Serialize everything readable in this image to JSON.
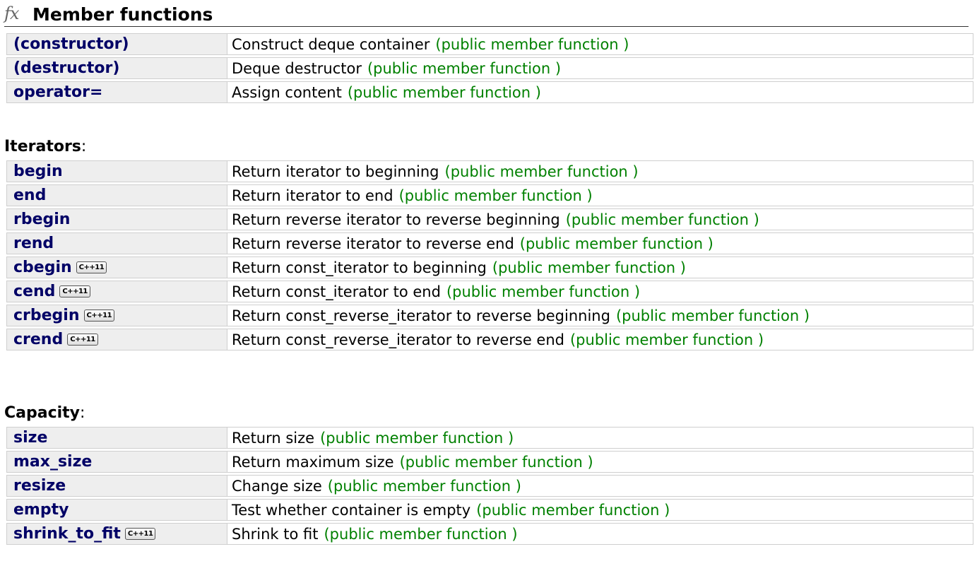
{
  "header": {
    "icon": "fx-icon",
    "title": "Member functions"
  },
  "colors": {
    "member_link": "#000066",
    "kind_text": "#008000",
    "name_cell_bg": "#eeeeee",
    "border": "#cfcfcf"
  },
  "groups": [
    {
      "title": "",
      "rows": [
        {
          "name": "(constructor)",
          "cpp11": false,
          "desc": "Construct deque container",
          "kind": "(public member function )"
        },
        {
          "name": "(destructor)",
          "cpp11": false,
          "desc": "Deque destructor",
          "kind": "(public member function )"
        },
        {
          "name": "operator=",
          "cpp11": false,
          "desc": "Assign content",
          "kind": "(public member function )"
        }
      ]
    },
    {
      "title": "Iterators",
      "rows": [
        {
          "name": "begin",
          "cpp11": false,
          "desc": "Return iterator to beginning",
          "kind": "(public member function )"
        },
        {
          "name": "end",
          "cpp11": false,
          "desc": "Return iterator to end",
          "kind": "(public member function )"
        },
        {
          "name": "rbegin",
          "cpp11": false,
          "desc": "Return reverse iterator to reverse beginning",
          "kind": "(public member function )"
        },
        {
          "name": "rend",
          "cpp11": false,
          "desc": "Return reverse iterator to reverse end",
          "kind": "(public member function )"
        },
        {
          "name": "cbegin",
          "cpp11": true,
          "desc": "Return const_iterator to beginning",
          "kind": "(public member function )"
        },
        {
          "name": "cend",
          "cpp11": true,
          "desc": "Return const_iterator to end",
          "kind": "(public member function )"
        },
        {
          "name": "crbegin",
          "cpp11": true,
          "desc": "Return const_reverse_iterator to reverse beginning",
          "kind": "(public member function )"
        },
        {
          "name": "crend",
          "cpp11": true,
          "desc": "Return const_reverse_iterator to reverse end",
          "kind": "(public member function )"
        }
      ]
    },
    {
      "title": "Capacity",
      "rows": [
        {
          "name": "size",
          "cpp11": false,
          "desc": "Return size",
          "kind": "(public member function )"
        },
        {
          "name": "max_size",
          "cpp11": false,
          "desc": "Return maximum size",
          "kind": "(public member function )"
        },
        {
          "name": "resize",
          "cpp11": false,
          "desc": "Change size",
          "kind": "(public member function )"
        },
        {
          "name": "empty",
          "cpp11": false,
          "desc": "Test whether container is empty",
          "kind": "(public member function )"
        },
        {
          "name": "shrink_to_fit",
          "cpp11": true,
          "desc": "Shrink to fit",
          "kind": "(public member function )"
        }
      ]
    }
  ],
  "badge_text": "C++11"
}
